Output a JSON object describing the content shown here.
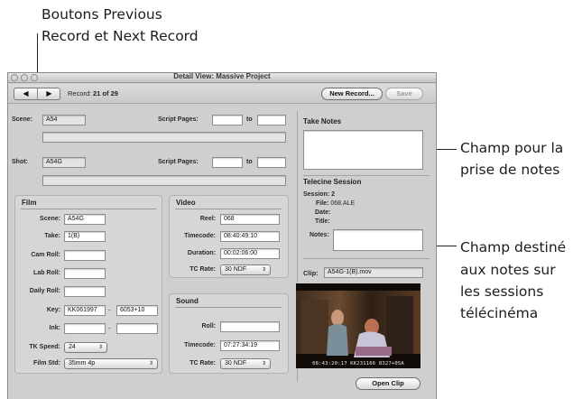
{
  "annotations": {
    "top": [
      "Boutons Previous",
      "Record et Next Record"
    ],
    "right_notes": [
      "Champ pour la",
      "prise de notes"
    ],
    "right_telecine": [
      "Champ destiné",
      "aux notes sur",
      "les sessions",
      "télécinéma"
    ]
  },
  "window": {
    "title": "Detail View: Massive Project",
    "nav": {
      "prev_icon": "◀",
      "next_icon": "▶"
    },
    "record_label": "Record:",
    "record_value": "21 of 29",
    "new_record_label": "New Record...",
    "save_label": "Save"
  },
  "scene": {
    "scene_label": "Scene:",
    "scene_value": "A54",
    "script_pages_label": "Script Pages:",
    "to_label": "to",
    "shot_label": "Shot:",
    "shot_value": "A54G",
    "shot_script_pages_label": "Script Pages:",
    "shot_to_label": "to"
  },
  "film": {
    "title": "Film",
    "scene_label": "Scene:",
    "scene_value": "A54G",
    "take_label": "Take:",
    "take_value": "1(B)",
    "cam_roll_label": "Cam Roll:",
    "lab_roll_label": "Lab Roll:",
    "daily_roll_label": "Daily Roll:",
    "key_label": "Key:",
    "key_value_1": "KK061997",
    "key_dash": "-",
    "key_value_2": "6053+10",
    "ink_label": "Ink:",
    "ink_dash": "-",
    "tk_speed_label": "TK Speed:",
    "tk_speed_value": "24",
    "film_std_label": "Film Std:",
    "film_std_value": "35mm 4p"
  },
  "video": {
    "title": "Video",
    "reel_label": "Reel:",
    "reel_value": "068",
    "timecode_label": "Timecode:",
    "timecode_value": "08:40:49:10",
    "duration_label": "Duration:",
    "duration_value": "00:02:06:00",
    "tc_rate_label": "TC Rate:",
    "tc_rate_value": "30 NDF"
  },
  "sound": {
    "title": "Sound",
    "roll_label": "Roll:",
    "timecode_label": "Timecode:",
    "timecode_value": "07:27:34:19",
    "tc_rate_label": "TC Rate:",
    "tc_rate_value": "30 NDF"
  },
  "take_notes": {
    "title": "Take Notes"
  },
  "telecine": {
    "title": "Telecine Session",
    "session_label": "Session:",
    "session_value": "2",
    "file_label": "File:",
    "file_value": "068.ALE",
    "date_label": "Date:",
    "title_label": "Title:",
    "notes_label": "Notes:"
  },
  "clip": {
    "label": "Clip:",
    "value": "A54G-1(B).mov",
    "burnin": "08:43:20:17   KK231166 8327+05A",
    "open_clip_label": "Open Clip"
  }
}
